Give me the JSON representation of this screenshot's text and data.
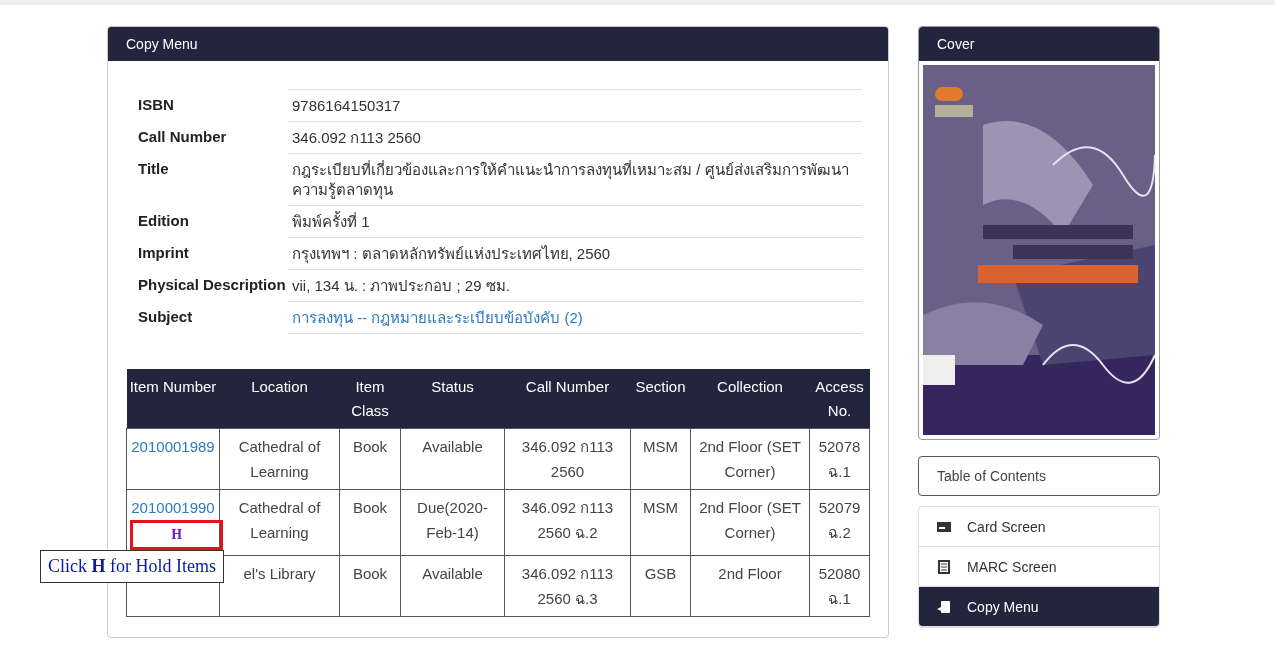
{
  "copy_menu": {
    "title": "Copy Menu",
    "fields": [
      {
        "label": "ISBN",
        "value": "9786164150317",
        "kind": "text"
      },
      {
        "label": "Call Number",
        "value": "346.092 ก113 2560",
        "kind": "text"
      },
      {
        "label": "Title",
        "value": "กฎระเบียบที่เกี่ยวข้องและการให้คำแนะนำการลงทุนที่เหมาะสม / ศูนย์ส่งเสริมการพัฒนาความรู้ตลาดทุน",
        "kind": "text"
      },
      {
        "label": "Edition",
        "value": "พิมพ์ครั้งที่ 1",
        "kind": "text"
      },
      {
        "label": "Imprint",
        "value": "กรุงเทพฯ : ตลาดหลักทรัพย์แห่งประเทศไทย, 2560",
        "kind": "text"
      },
      {
        "label": "Physical Description",
        "value": "vii, 134 น. : ภาพประกอบ ; 29 ซม.",
        "kind": "text"
      },
      {
        "label": "Subject",
        "value": "การลงทุน -- กฎหมายและระเบียบข้อบังคับ (2)",
        "kind": "link"
      }
    ],
    "table": {
      "columns": [
        "Item Number",
        "Location",
        "Item Class",
        "Status",
        "Call Number",
        "Section",
        "Collection",
        "Access No."
      ],
      "rows": [
        {
          "item_number": "2010001989",
          "location": "Cathedral of Learning",
          "item_class": "Book",
          "status": "Available",
          "call_number": "346.092 ก113 2560",
          "section": "MSM",
          "collection": "2nd Floor (SET Corner)",
          "access_no": "52078 ฉ.1"
        },
        {
          "item_number": "2010001990",
          "hold": "H",
          "location": "Cathedral of Learning",
          "item_class": "Book",
          "status": "Due(2020-Feb-14)",
          "call_number": "346.092 ก113 2560 ฉ.2",
          "section": "MSM",
          "collection": "2nd Floor (SET Corner)",
          "access_no": "52079 ฉ.2"
        },
        {
          "location": "el's Library",
          "item_class": "Book",
          "status": "Available",
          "call_number": "346.092 ก113 2560 ฉ.3",
          "section": "GSB",
          "collection": "2nd Floor",
          "access_no": "52080 ฉ.1"
        }
      ]
    },
    "callout": "Click **H** for Hold Items"
  },
  "cover": {
    "title": "Cover"
  },
  "table_of_contents": "Table of Contents",
  "menu": [
    {
      "label": "Card Screen",
      "kind": "card",
      "selected": false
    },
    {
      "label": "MARC Screen",
      "kind": "list",
      "selected": false
    },
    {
      "label": "Copy Menu",
      "kind": "copy",
      "selected": true
    }
  ]
}
